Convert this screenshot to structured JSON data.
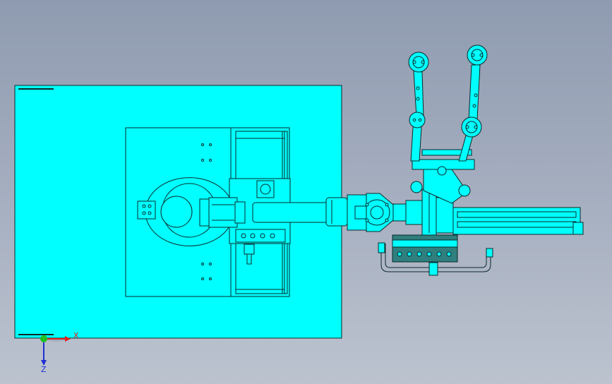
{
  "viewport": {
    "background_top": "#8f9bb0",
    "background_bottom": "#bcc3cf"
  },
  "model": {
    "fill_color": "#00ffff",
    "edge_color": "#0b2a2a",
    "dark_part_color": "#2f7f7f"
  },
  "triad": {
    "x_label": "X",
    "z_label": "Z",
    "x_color": "#e02020",
    "z_color": "#2030d0",
    "y_color": "#20c020"
  }
}
